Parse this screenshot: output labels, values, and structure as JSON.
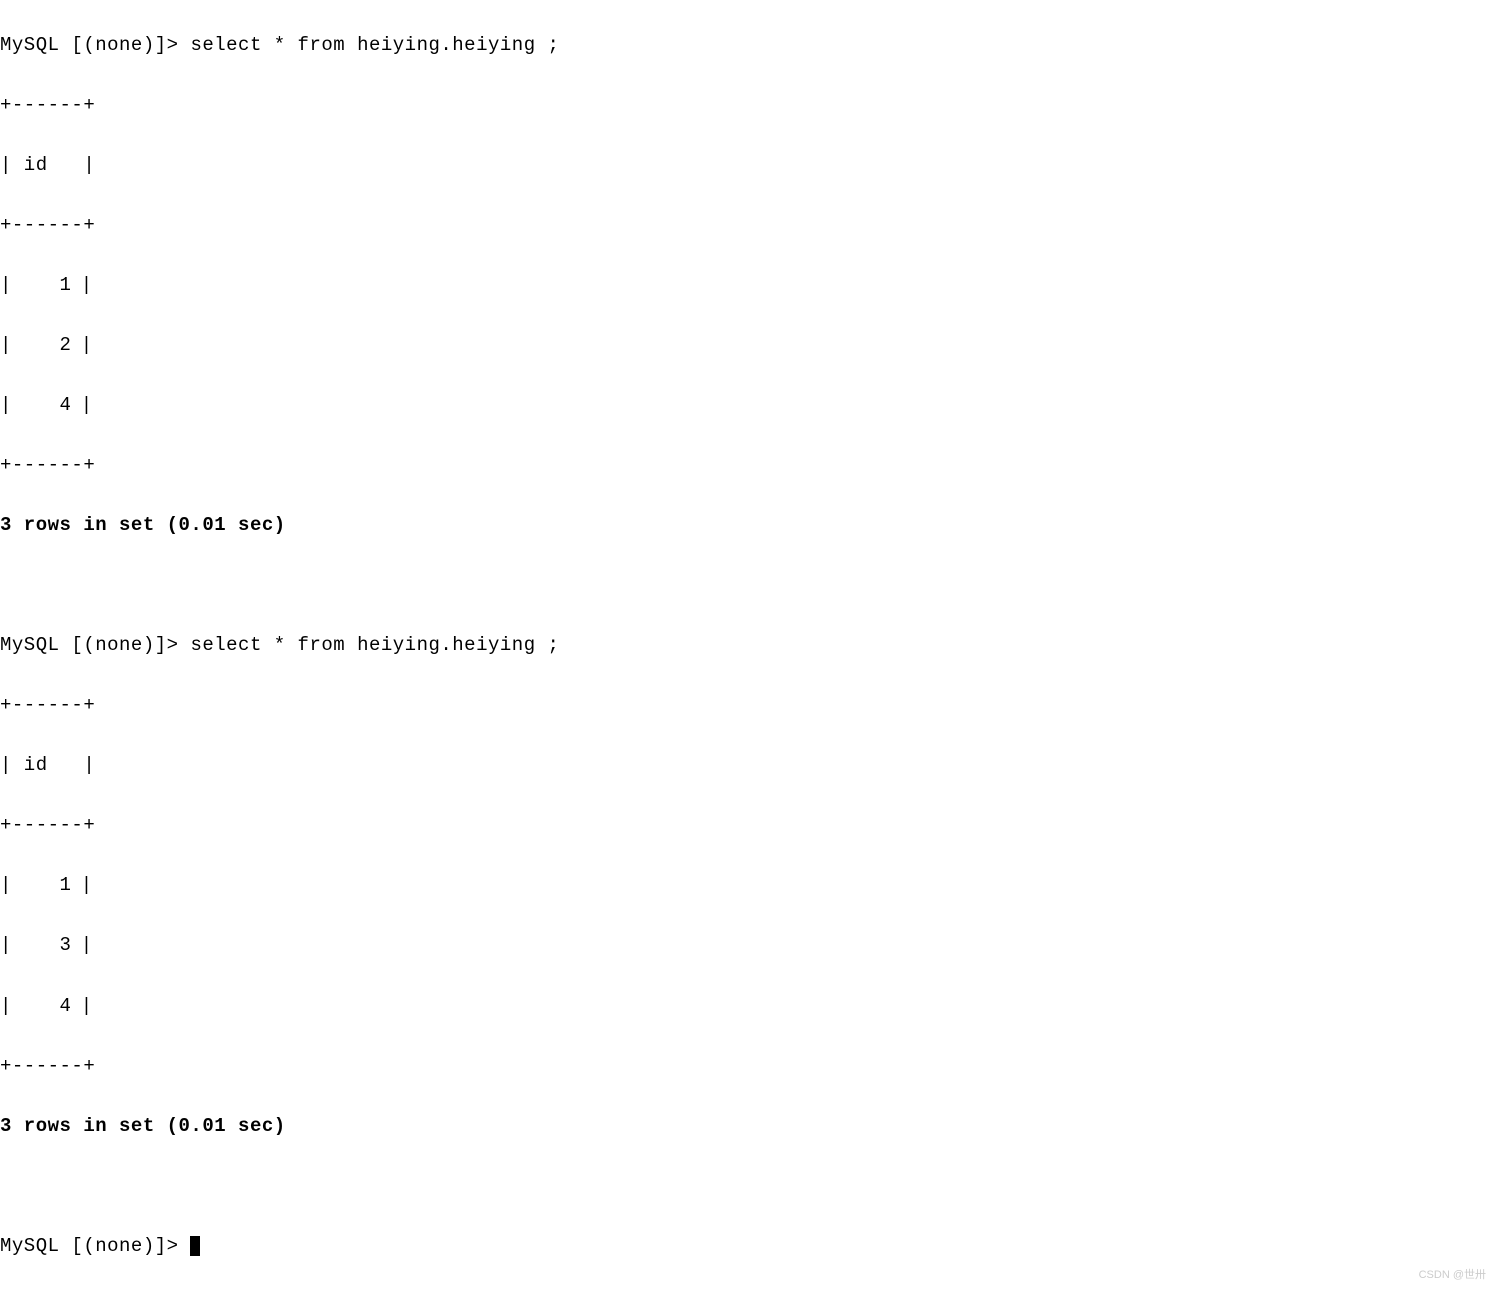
{
  "queries": [
    {
      "prompt": "MySQL [(none)]> ",
      "command": "select * from heiying.heiying ;",
      "table": {
        "border": "+------+",
        "header": "| id   |",
        "rows": [
          "    1",
          "    2",
          "    4"
        ]
      },
      "status": "3 rows in set (0.01 sec)"
    },
    {
      "prompt": "MySQL [(none)]> ",
      "command": "select * from heiying.heiying ;",
      "table": {
        "border": "+------+",
        "header": "| id   |",
        "rows": [
          "    1",
          "    3",
          "    4"
        ]
      },
      "status": "3 rows in set (0.01 sec)"
    }
  ],
  "final_prompt": "MySQL [(none)]> ",
  "watermark": "CSDN @世卅"
}
